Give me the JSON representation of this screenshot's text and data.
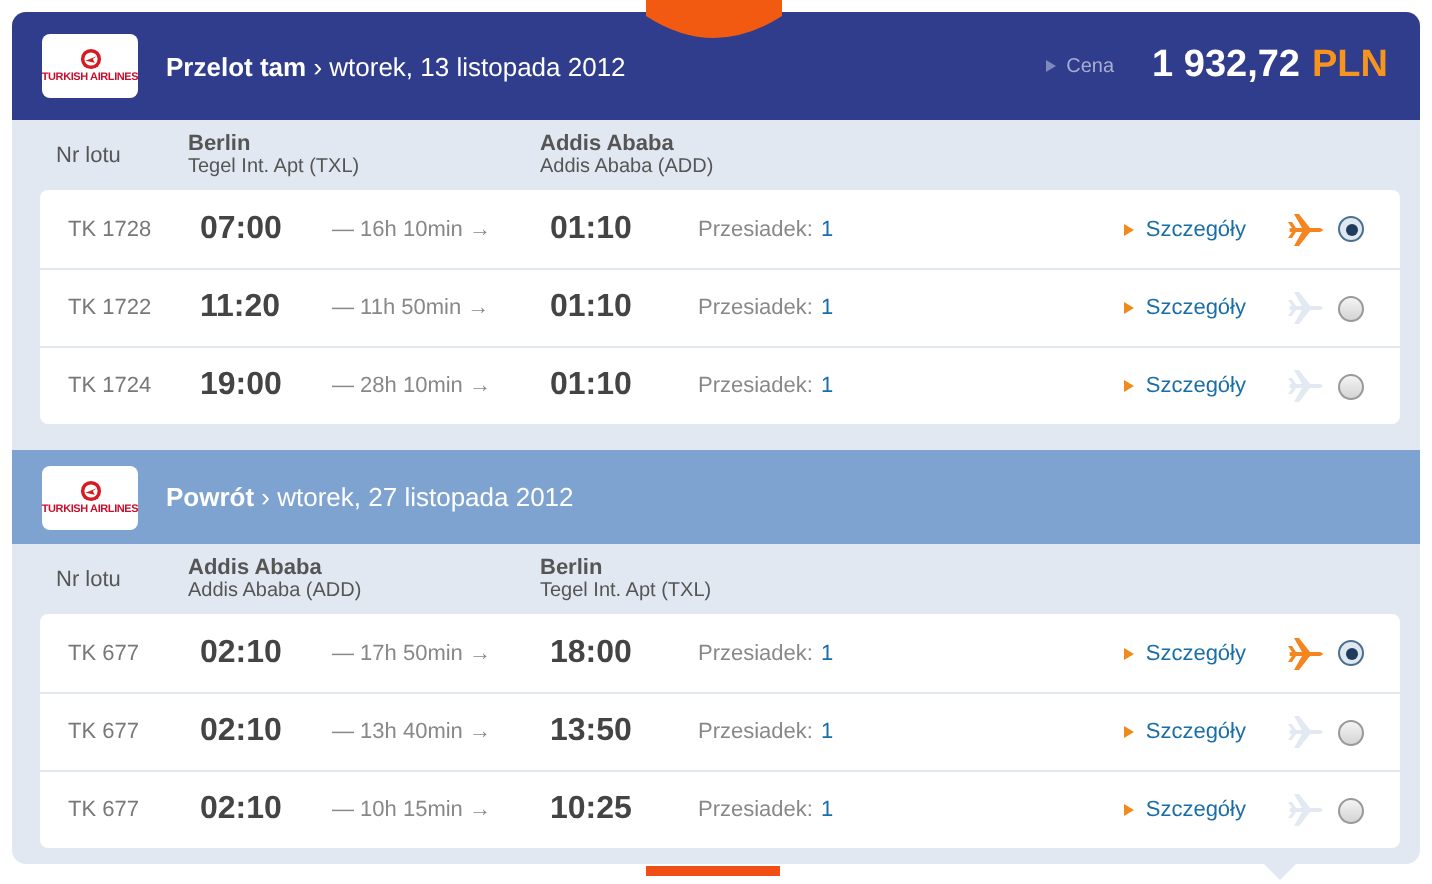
{
  "price": {
    "label": "Cena",
    "amount": "1 932,72",
    "currency": "PLN"
  },
  "sections": [
    {
      "kind": "outbound",
      "airline_logo": "TURKISH AIRLINES",
      "title": "**Przelot tam** › wtorek, 13 listopada 2012",
      "columns": {
        "flight": "Nr lotu",
        "from_city": "Berlin",
        "from_airport": "Tegel Int. Apt (TXL)",
        "to_city": "Addis Ababa",
        "to_airport": "Addis Ababa (ADD)"
      },
      "rows": [
        {
          "flight": "TK 1728",
          "departure": "07:00",
          "duration": "— 16h 10min →",
          "arrival": "01:10",
          "stops_label": "Przesiadek:",
          "stops": "1",
          "details": "Szczegóły",
          "selected": true
        },
        {
          "flight": "TK 1722",
          "departure": "11:20",
          "duration": "— 11h 50min →",
          "arrival": "01:10",
          "stops_label": "Przesiadek:",
          "stops": "1",
          "details": "Szczegóły",
          "selected": false
        },
        {
          "flight": "TK 1724",
          "departure": "19:00",
          "duration": "— 28h 10min →",
          "arrival": "01:10",
          "stops_label": "Przesiadek:",
          "stops": "1",
          "details": "Szczegóły",
          "selected": false
        }
      ]
    },
    {
      "kind": "return",
      "airline_logo": "TURKISH AIRLINES",
      "title": "**Powrót** › wtorek, 27 listopada 2012",
      "columns": {
        "flight": "Nr lotu",
        "from_city": "Addis Ababa",
        "from_airport": "Addis Ababa (ADD)",
        "to_city": "Berlin",
        "to_airport": "Tegel Int. Apt (TXL)"
      },
      "rows": [
        {
          "flight": "TK 677",
          "departure": "02:10",
          "duration": "— 17h 50min →",
          "arrival": "18:00",
          "stops_label": "Przesiadek:",
          "stops": "1",
          "details": "Szczegóły",
          "selected": true
        },
        {
          "flight": "TK 677",
          "departure": "02:10",
          "duration": "— 13h 40min →",
          "arrival": "13:50",
          "stops_label": "Przesiadek:",
          "stops": "1",
          "details": "Szczegóły",
          "selected": false
        },
        {
          "flight": "TK 677",
          "departure": "02:10",
          "duration": "— 10h 15min →",
          "arrival": "10:25",
          "stops_label": "Przesiadek:",
          "stops": "1",
          "details": "Szczegóły",
          "selected": false
        }
      ]
    }
  ]
}
